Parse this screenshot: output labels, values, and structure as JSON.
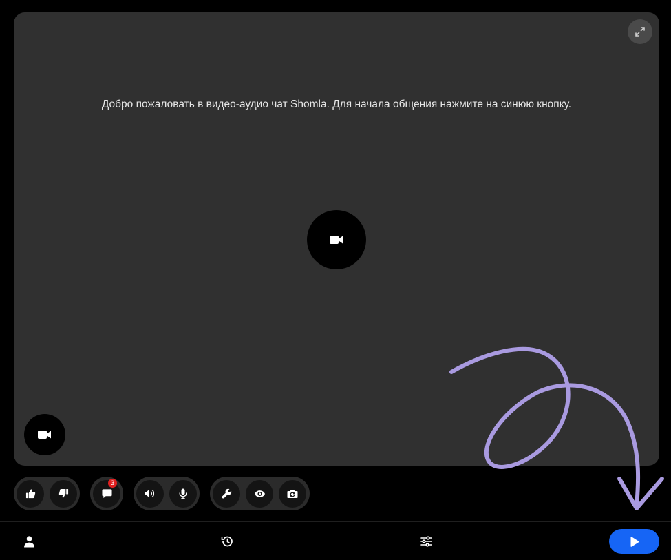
{
  "welcome": {
    "text": "Добро пожаловать в видео-аудио чат Shomla. Для начала общения нажмите на синюю кнопку."
  },
  "chat": {
    "unread_count": "3"
  },
  "icons": {
    "fullscreen": "expand-arrows-icon",
    "center_camera": "video-camera-icon",
    "self_camera": "video-camera-icon",
    "like": "thumbs-up-icon",
    "dislike": "thumbs-down-icon",
    "chat": "chat-bubble-icon",
    "volume": "speaker-volume-icon",
    "mic": "microphone-icon",
    "settings": "wrench-icon",
    "visibility": "eye-icon",
    "switch_camera": "camera-rotate-icon",
    "profile": "user-icon",
    "history": "history-clock-icon",
    "filters": "sliders-icon",
    "start": "play-icon"
  },
  "colors": {
    "accent": "#1665f5",
    "panel": "#303030",
    "badge": "#e02020",
    "annotation": "#a99ae0"
  }
}
